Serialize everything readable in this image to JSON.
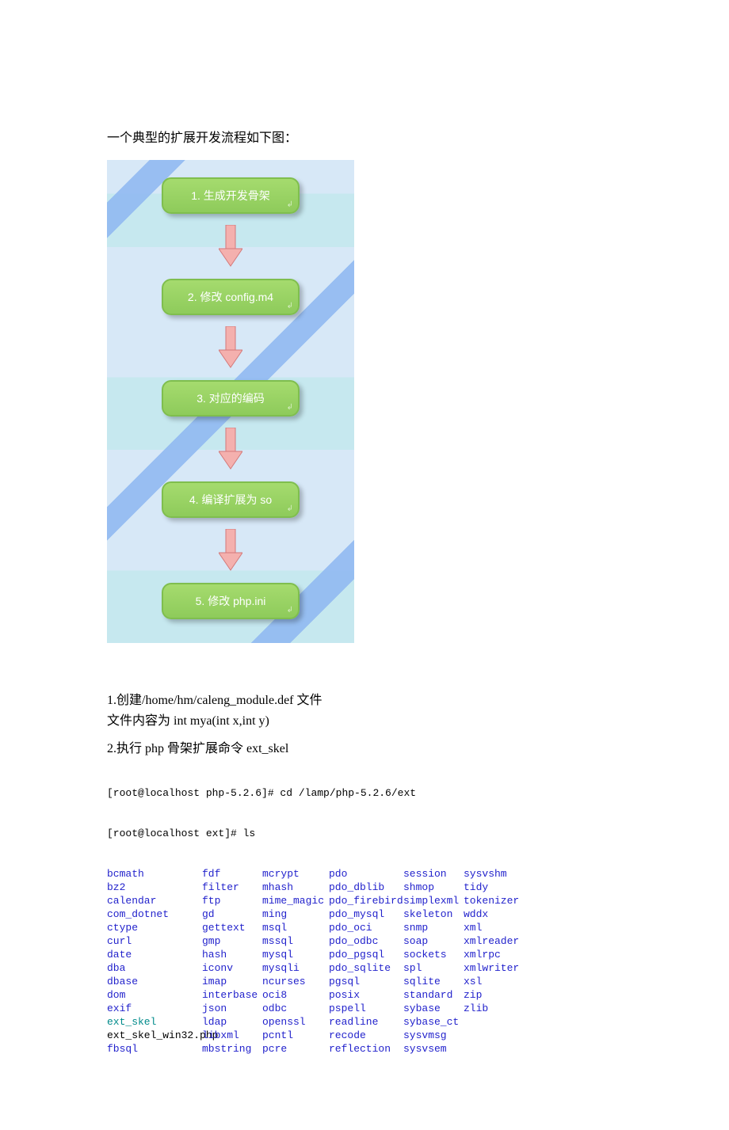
{
  "intro": "一个典型的扩展开发流程如下图：",
  "flow": {
    "steps": [
      "1. 生成开发骨架",
      "2. 修改 config.m4",
      "3. 对应的编码",
      "4. 编译扩展为 so",
      "5. 修改 php.ini"
    ]
  },
  "section1": {
    "line1": "1.创建/home/hm/caleng_module.def 文件",
    "line2": "文件内容为 int mya(int x,int y)"
  },
  "section2": {
    "title": "2.执行 php 骨架扩展命令 ext_skel",
    "prompt1": "[root@localhost php-5.2.6]# cd /lamp/php-5.2.6/ext",
    "prompt2": "[root@localhost ext]# ls",
    "cols": [
      [
        "bcmath",
        "bz2",
        "calendar",
        "com_dotnet",
        "ctype",
        "curl",
        "date",
        "dba",
        "dbase",
        "dom",
        "exif",
        "ext_skel",
        "ext_skel_win32.php",
        "fbsql"
      ],
      [
        "fdf",
        "filter",
        "ftp",
        "gd",
        "gettext",
        "gmp",
        "hash",
        "iconv",
        "imap",
        "interbase",
        "json",
        "ldap",
        "libxml",
        "mbstring"
      ],
      [
        "mcrypt",
        "mhash",
        "mime_magic",
        "ming",
        "msql",
        "mssql",
        "mysql",
        "mysqli",
        "ncurses",
        "oci8",
        "odbc",
        "openssl",
        "pcntl",
        "pcre"
      ],
      [
        "pdo",
        "pdo_dblib",
        "pdo_firebird",
        "pdo_mysql",
        "pdo_oci",
        "pdo_odbc",
        "pdo_pgsql",
        "pdo_sqlite",
        "pgsql",
        "posix",
        "pspell",
        "readline",
        "recode",
        "reflection"
      ],
      [
        "session",
        "shmop",
        "simplexml",
        "skeleton",
        "snmp",
        "soap",
        "sockets",
        "spl",
        "sqlite",
        "standard",
        "sybase",
        "sybase_ct",
        "sysvmsg",
        "sysvsem"
      ],
      [
        "sysvshm",
        "tidy",
        "tokenizer",
        "wddx",
        "xml",
        "xmlreader",
        "xmlrpc",
        "xmlwriter",
        "xsl",
        "zip",
        "zlib",
        "",
        "",
        ""
      ]
    ],
    "teal": [
      "ext_skel"
    ],
    "plain": [
      "ext_skel_win32.php"
    ]
  }
}
